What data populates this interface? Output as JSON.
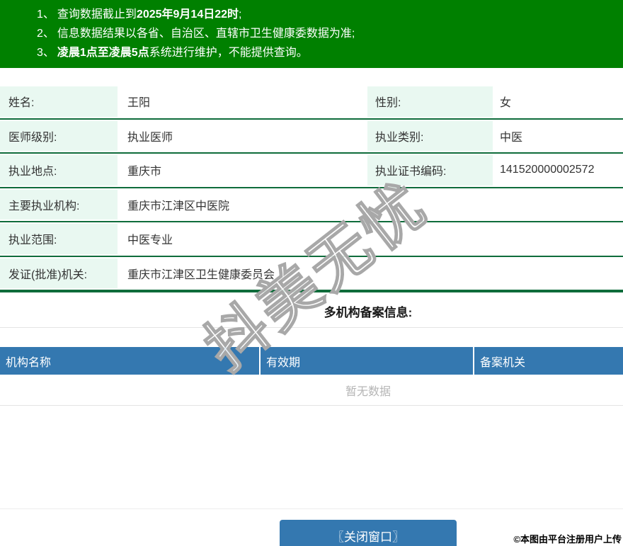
{
  "banner": {
    "notices": [
      {
        "num": "1、",
        "pre": "查询数据截止到",
        "bold": "2025年9月14日22时",
        "post": ";"
      },
      {
        "num": "2、",
        "pre": "信息数据结果以各省、自治区、直辖市卫生健康委数据为准;",
        "bold": "",
        "post": ""
      },
      {
        "num": "3、",
        "pre": "",
        "bold": "凌晨1点至凌晨5点",
        "post": "系统进行维护，不能提供查询。"
      }
    ]
  },
  "info_rows": [
    {
      "cells": [
        {
          "label": "姓名:",
          "value": "王阳"
        },
        {
          "label": "性别:",
          "value": "女"
        }
      ]
    },
    {
      "cells": [
        {
          "label": "医师级别:",
          "value": "执业医师"
        },
        {
          "label": "执业类别:",
          "value": "中医"
        }
      ]
    },
    {
      "cells": [
        {
          "label": "执业地点:",
          "value": "重庆市"
        },
        {
          "label": "执业证书编码:",
          "value": "141520000002572"
        }
      ]
    },
    {
      "cells": [
        {
          "label": "主要执业机构:",
          "value": "重庆市江津区中医院"
        }
      ]
    },
    {
      "cells": [
        {
          "label": "执业范围:",
          "value": "中医专业"
        }
      ]
    },
    {
      "cells": [
        {
          "label": "发证(批准)机关:",
          "value": "重庆市江津区卫生健康委员会"
        }
      ]
    }
  ],
  "filing": {
    "title": "多机构备案信息:",
    "columns": [
      "机构名称",
      "有效期",
      "备案机关"
    ],
    "empty_text": "暂无数据"
  },
  "footer": {
    "close_button": "〖关闭窗口〗",
    "stamp": "©本图由平台注册用户上传"
  },
  "watermark": {
    "text": "抖美无忧"
  },
  "colors": {
    "banner_green": "#008000",
    "divider_green": "#0f6c3b",
    "label_mint": "#e9f8f1",
    "header_blue": "#3478b0",
    "empty_text_gray": "#b5b5b5"
  }
}
